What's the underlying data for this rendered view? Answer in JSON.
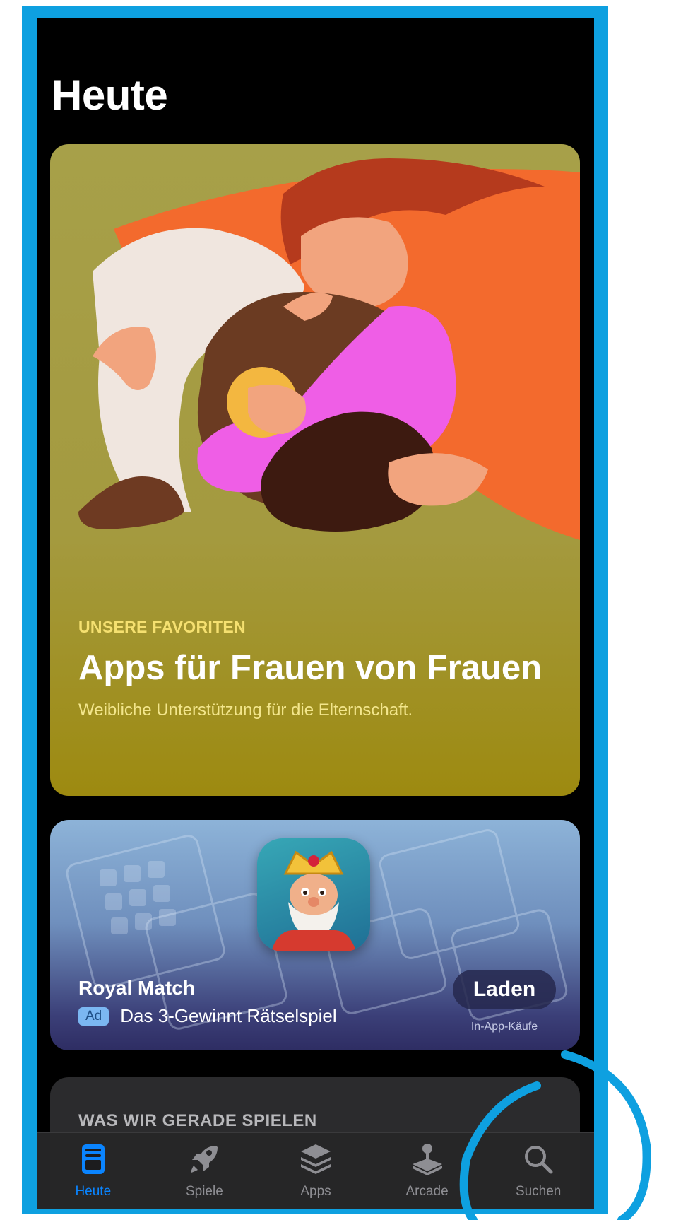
{
  "header": {
    "title": "Heute"
  },
  "featured": {
    "eyebrow": "UNSERE FAVORITEN",
    "title": "Apps für Frauen von Frauen",
    "subtitle": "Weibliche Unterstützung für die Elternschaft."
  },
  "ad_card": {
    "app_name": "Royal Match",
    "badge": "Ad",
    "subtitle": "Das 3-Gewinnt Rätselspiel",
    "button_label": "Laden",
    "iap_note": "In-App-Käufe"
  },
  "next_card": {
    "label": "WAS WIR GERADE SPIELEN"
  },
  "tabbar": {
    "items": [
      {
        "label": "Heute",
        "icon": "today-icon",
        "active": true
      },
      {
        "label": "Spiele",
        "icon": "rocket-icon",
        "active": false
      },
      {
        "label": "Apps",
        "icon": "layers-icon",
        "active": false
      },
      {
        "label": "Arcade",
        "icon": "joystick-icon",
        "active": false
      },
      {
        "label": "Suchen",
        "icon": "search-icon",
        "active": false
      }
    ],
    "active_color": "#0a84ff",
    "inactive_color": "#8e8e93"
  },
  "colors": {
    "frame": "#0ea0e0",
    "annotation_circle": "#0ea0e0"
  }
}
